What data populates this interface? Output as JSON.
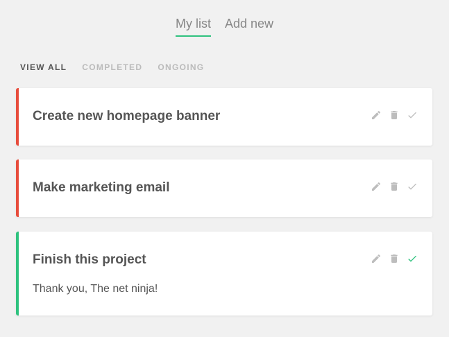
{
  "nav": {
    "links": [
      "My list",
      "Add new"
    ]
  },
  "filters": [
    "VIEW ALL",
    "COMPLETED",
    "ONGOING"
  ],
  "projects": [
    {
      "title": "Create new homepage banner",
      "details": "",
      "complete": false
    },
    {
      "title": "Make marketing email",
      "details": "",
      "complete": false
    },
    {
      "title": "Finish this project",
      "details": "Thank you, The net ninja!",
      "complete": true
    }
  ],
  "colors": {
    "accent": "#2ec27e",
    "ongoing": "#e74c3c",
    "icon": "#bdbdbd"
  },
  "icons": [
    "edit-icon",
    "delete-icon",
    "check-icon"
  ]
}
